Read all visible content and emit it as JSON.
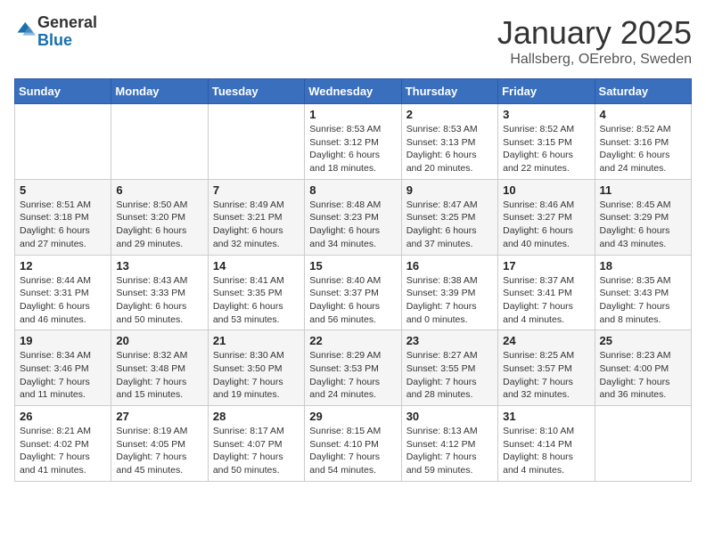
{
  "header": {
    "logo_general": "General",
    "logo_blue": "Blue",
    "month_title": "January 2025",
    "location": "Hallsberg, OErebro, Sweden"
  },
  "weekdays": [
    "Sunday",
    "Monday",
    "Tuesday",
    "Wednesday",
    "Thursday",
    "Friday",
    "Saturday"
  ],
  "weeks": [
    [
      {
        "day": "",
        "info": ""
      },
      {
        "day": "",
        "info": ""
      },
      {
        "day": "",
        "info": ""
      },
      {
        "day": "1",
        "info": "Sunrise: 8:53 AM\nSunset: 3:12 PM\nDaylight: 6 hours and 18 minutes."
      },
      {
        "day": "2",
        "info": "Sunrise: 8:53 AM\nSunset: 3:13 PM\nDaylight: 6 hours and 20 minutes."
      },
      {
        "day": "3",
        "info": "Sunrise: 8:52 AM\nSunset: 3:15 PM\nDaylight: 6 hours and 22 minutes."
      },
      {
        "day": "4",
        "info": "Sunrise: 8:52 AM\nSunset: 3:16 PM\nDaylight: 6 hours and 24 minutes."
      }
    ],
    [
      {
        "day": "5",
        "info": "Sunrise: 8:51 AM\nSunset: 3:18 PM\nDaylight: 6 hours and 27 minutes."
      },
      {
        "day": "6",
        "info": "Sunrise: 8:50 AM\nSunset: 3:20 PM\nDaylight: 6 hours and 29 minutes."
      },
      {
        "day": "7",
        "info": "Sunrise: 8:49 AM\nSunset: 3:21 PM\nDaylight: 6 hours and 32 minutes."
      },
      {
        "day": "8",
        "info": "Sunrise: 8:48 AM\nSunset: 3:23 PM\nDaylight: 6 hours and 34 minutes."
      },
      {
        "day": "9",
        "info": "Sunrise: 8:47 AM\nSunset: 3:25 PM\nDaylight: 6 hours and 37 minutes."
      },
      {
        "day": "10",
        "info": "Sunrise: 8:46 AM\nSunset: 3:27 PM\nDaylight: 6 hours and 40 minutes."
      },
      {
        "day": "11",
        "info": "Sunrise: 8:45 AM\nSunset: 3:29 PM\nDaylight: 6 hours and 43 minutes."
      }
    ],
    [
      {
        "day": "12",
        "info": "Sunrise: 8:44 AM\nSunset: 3:31 PM\nDaylight: 6 hours and 46 minutes."
      },
      {
        "day": "13",
        "info": "Sunrise: 8:43 AM\nSunset: 3:33 PM\nDaylight: 6 hours and 50 minutes."
      },
      {
        "day": "14",
        "info": "Sunrise: 8:41 AM\nSunset: 3:35 PM\nDaylight: 6 hours and 53 minutes."
      },
      {
        "day": "15",
        "info": "Sunrise: 8:40 AM\nSunset: 3:37 PM\nDaylight: 6 hours and 56 minutes."
      },
      {
        "day": "16",
        "info": "Sunrise: 8:38 AM\nSunset: 3:39 PM\nDaylight: 7 hours and 0 minutes."
      },
      {
        "day": "17",
        "info": "Sunrise: 8:37 AM\nSunset: 3:41 PM\nDaylight: 7 hours and 4 minutes."
      },
      {
        "day": "18",
        "info": "Sunrise: 8:35 AM\nSunset: 3:43 PM\nDaylight: 7 hours and 8 minutes."
      }
    ],
    [
      {
        "day": "19",
        "info": "Sunrise: 8:34 AM\nSunset: 3:46 PM\nDaylight: 7 hours and 11 minutes."
      },
      {
        "day": "20",
        "info": "Sunrise: 8:32 AM\nSunset: 3:48 PM\nDaylight: 7 hours and 15 minutes."
      },
      {
        "day": "21",
        "info": "Sunrise: 8:30 AM\nSunset: 3:50 PM\nDaylight: 7 hours and 19 minutes."
      },
      {
        "day": "22",
        "info": "Sunrise: 8:29 AM\nSunset: 3:53 PM\nDaylight: 7 hours and 24 minutes."
      },
      {
        "day": "23",
        "info": "Sunrise: 8:27 AM\nSunset: 3:55 PM\nDaylight: 7 hours and 28 minutes."
      },
      {
        "day": "24",
        "info": "Sunrise: 8:25 AM\nSunset: 3:57 PM\nDaylight: 7 hours and 32 minutes."
      },
      {
        "day": "25",
        "info": "Sunrise: 8:23 AM\nSunset: 4:00 PM\nDaylight: 7 hours and 36 minutes."
      }
    ],
    [
      {
        "day": "26",
        "info": "Sunrise: 8:21 AM\nSunset: 4:02 PM\nDaylight: 7 hours and 41 minutes."
      },
      {
        "day": "27",
        "info": "Sunrise: 8:19 AM\nSunset: 4:05 PM\nDaylight: 7 hours and 45 minutes."
      },
      {
        "day": "28",
        "info": "Sunrise: 8:17 AM\nSunset: 4:07 PM\nDaylight: 7 hours and 50 minutes."
      },
      {
        "day": "29",
        "info": "Sunrise: 8:15 AM\nSunset: 4:10 PM\nDaylight: 7 hours and 54 minutes."
      },
      {
        "day": "30",
        "info": "Sunrise: 8:13 AM\nSunset: 4:12 PM\nDaylight: 7 hours and 59 minutes."
      },
      {
        "day": "31",
        "info": "Sunrise: 8:10 AM\nSunset: 4:14 PM\nDaylight: 8 hours and 4 minutes."
      },
      {
        "day": "",
        "info": ""
      }
    ]
  ]
}
